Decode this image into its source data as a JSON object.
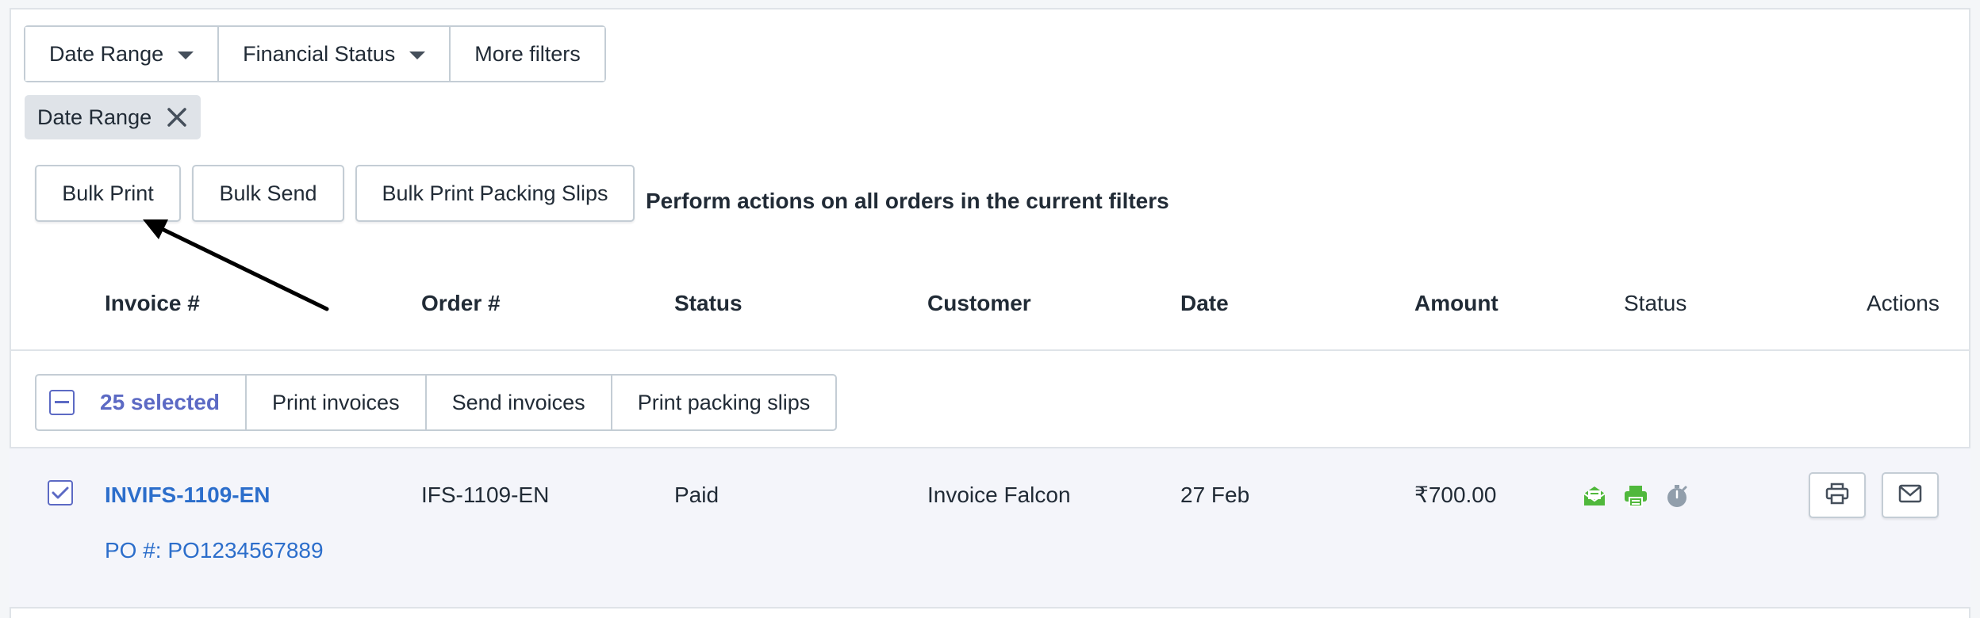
{
  "filters": {
    "date_range": "Date Range",
    "financial_status": "Financial Status",
    "more_filters": "More filters"
  },
  "applied_tag": {
    "label": "Date Range"
  },
  "bulk": {
    "print": "Bulk Print",
    "send": "Bulk Send",
    "packing_slips": "Bulk Print Packing Slips",
    "hint": "Perform actions on all orders in the current filters"
  },
  "table": {
    "headers": {
      "invoice": "Invoice #",
      "order": "Order #",
      "status": "Status",
      "customer": "Customer",
      "date": "Date",
      "amount": "Amount",
      "status2": "Status",
      "actions": "Actions"
    }
  },
  "selection": {
    "count": "25 selected",
    "print_invoices": "Print invoices",
    "send_invoices": "Send invoices",
    "print_packing_slips": "Print packing slips"
  },
  "rows": [
    {
      "invoice": "INVIFS-1109-EN",
      "po": "PO #: PO1234567889",
      "order": "IFS-1109-EN",
      "status": "Paid",
      "customer": "Invoice Falcon",
      "date": "27 Feb",
      "amount": "₹700.00",
      "status_icons": [
        "email-sent-icon",
        "printed-icon",
        "timer-icon"
      ]
    }
  ],
  "colors": {
    "accent": "#5c6ac4",
    "link": "#2c6ecb",
    "status_green": "#50b83c",
    "status_gray": "#919eab"
  }
}
